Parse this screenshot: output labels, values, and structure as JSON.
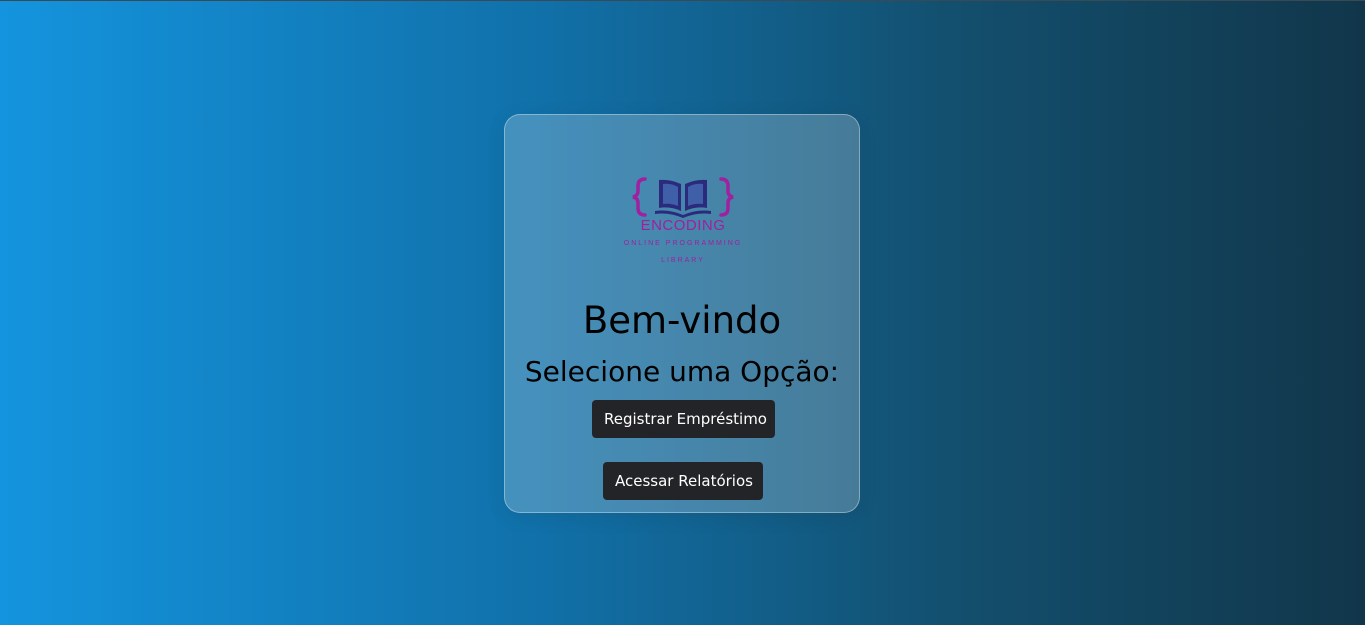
{
  "logo": {
    "brand": "ENCODING",
    "tagline_line1": "ONLINE PROGRAMMING",
    "tagline_line2": "LIBRARY",
    "icon": "book-braces-icon",
    "colors": {
      "braces": "#a020a0",
      "book": "#2c2a7c",
      "text": "#a020a0"
    }
  },
  "welcome": {
    "title": "Bem-vindo",
    "subtitle": "Selecione uma Opção:"
  },
  "actions": {
    "register_loan": "Registrar Empréstimo",
    "access_reports": "Acessar Relatórios"
  },
  "colors": {
    "gradient_start": "#1494de",
    "gradient_end": "#11364a",
    "button_bg": "#232427",
    "button_text": "#ffffff"
  }
}
